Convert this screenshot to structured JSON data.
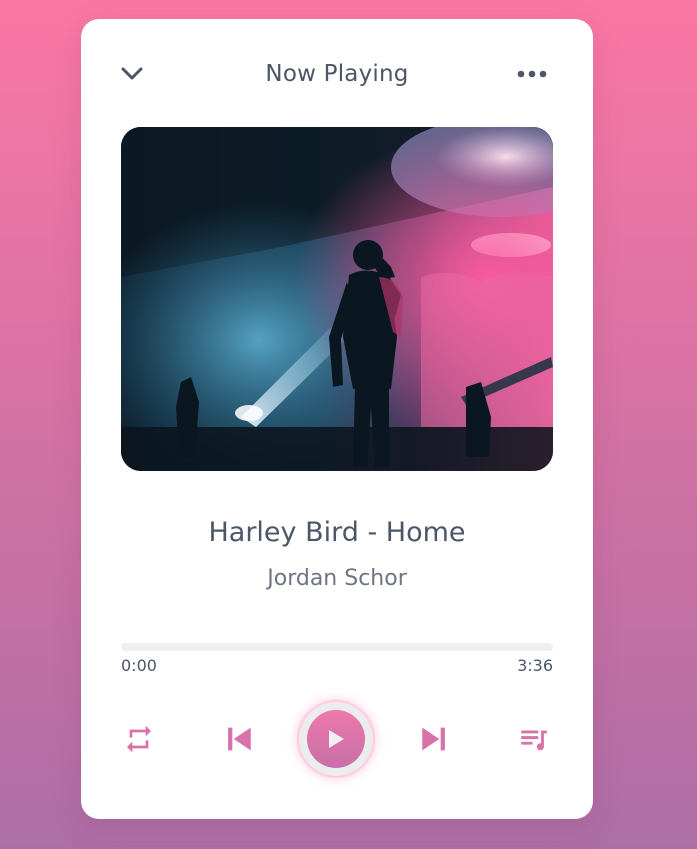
{
  "header": {
    "title": "Now Playing",
    "collapse_icon": "chevron-down-icon",
    "more_icon": "more-horizontal-icon"
  },
  "track": {
    "title": "Harley Bird - Home",
    "artist": "Jordan Schor"
  },
  "progress": {
    "current_time": "0:00",
    "total_time": "3:36",
    "fraction": 0
  },
  "controls": {
    "repeat_icon": "repeat-icon",
    "previous_icon": "skip-previous-icon",
    "play_icon": "play-icon",
    "next_icon": "skip-next-icon",
    "queue_icon": "playlist-icon"
  },
  "colors": {
    "accent": "#d872a8",
    "text_primary": "#4b5668",
    "background_top": "#fb77a3",
    "background_bottom": "#ad6ea6"
  }
}
